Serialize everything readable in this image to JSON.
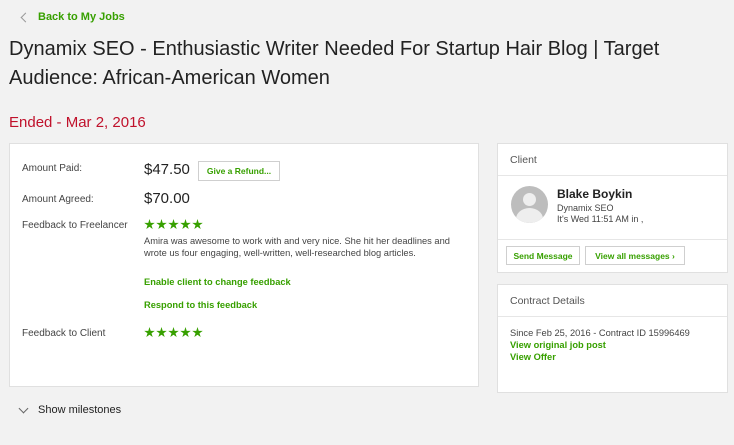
{
  "nav": {
    "back_label": "Back to My Jobs"
  },
  "job": {
    "title": "Dynamix SEO - Enthusiastic Writer Needed For Startup Hair Blog | Target Audience: African-American Women",
    "status": "Ended - Mar 2, 2016"
  },
  "payment": {
    "amount_paid_label": "Amount Paid:",
    "amount_paid": "$47.50",
    "refund_label": "Give a Refund...",
    "amount_agreed_label": "Amount Agreed:",
    "amount_agreed": "$70.00"
  },
  "feedback": {
    "to_freelancer_label": "Feedback to Freelancer",
    "to_freelancer_stars": 5,
    "to_freelancer_text": "Amira was awesome to work with and very nice. She hit her deadlines and wrote us four engaging, well-written, well-researched blog articles.",
    "enable_change_label": "Enable client to change feedback",
    "respond_label": "Respond to this feedback",
    "to_client_label": "Feedback to Client",
    "to_client_stars": 5
  },
  "milestones": {
    "label": "Show milestones"
  },
  "client": {
    "header": "Client",
    "name": "Blake Boykin",
    "company": "Dynamix SEO",
    "local_time": "It's Wed 11:51 AM in ,",
    "send_message_label": "Send Message",
    "view_messages_label": "View all messages ›"
  },
  "contract": {
    "header": "Contract Details",
    "since_text": "Since Feb 25, 2016 - Contract ID 15996469",
    "view_post_label": "View original job post",
    "view_offer_label": "View Offer"
  },
  "colors": {
    "accent": "#37a000",
    "status": "#c0112b",
    "background": "#f2f2f2"
  }
}
